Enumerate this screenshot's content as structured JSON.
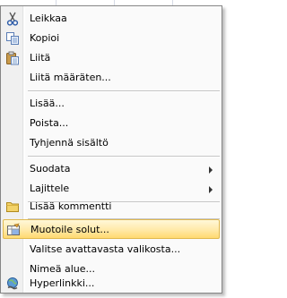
{
  "menu": {
    "items": [
      {
        "label": "Leikkaa",
        "icon": "scissors-icon"
      },
      {
        "label": "Kopioi",
        "icon": "copy-icon"
      },
      {
        "label": "Liitä",
        "icon": "paste-icon"
      },
      {
        "label": "Liitä määräten...",
        "icon": ""
      },
      {
        "label": "Lisää...",
        "icon": ""
      },
      {
        "label": "Poista...",
        "icon": ""
      },
      {
        "label": "Tyhjennä sisältö",
        "icon": ""
      },
      {
        "label": "Suodata",
        "icon": "",
        "submenu": true
      },
      {
        "label": "Lajittele",
        "icon": "",
        "submenu": true
      },
      {
        "label": "Lisää kommentti",
        "icon": "comment-icon"
      },
      {
        "label": "Muotoile solut...",
        "icon": "format-cells-icon",
        "highlighted": true
      },
      {
        "label": "Valitse avattavasta valikosta...",
        "icon": ""
      },
      {
        "label": "Nimeä alue...",
        "icon": ""
      },
      {
        "label": "Hyperlinkki...",
        "icon": "hyperlink-icon"
      }
    ]
  },
  "colors": {
    "highlight_top": "#fff8d9",
    "highlight_bottom": "#ffd970",
    "highlight_border": "#e0b94f",
    "menu_bg": "#fafafa",
    "gutter_bg": "#f0f0f0"
  }
}
